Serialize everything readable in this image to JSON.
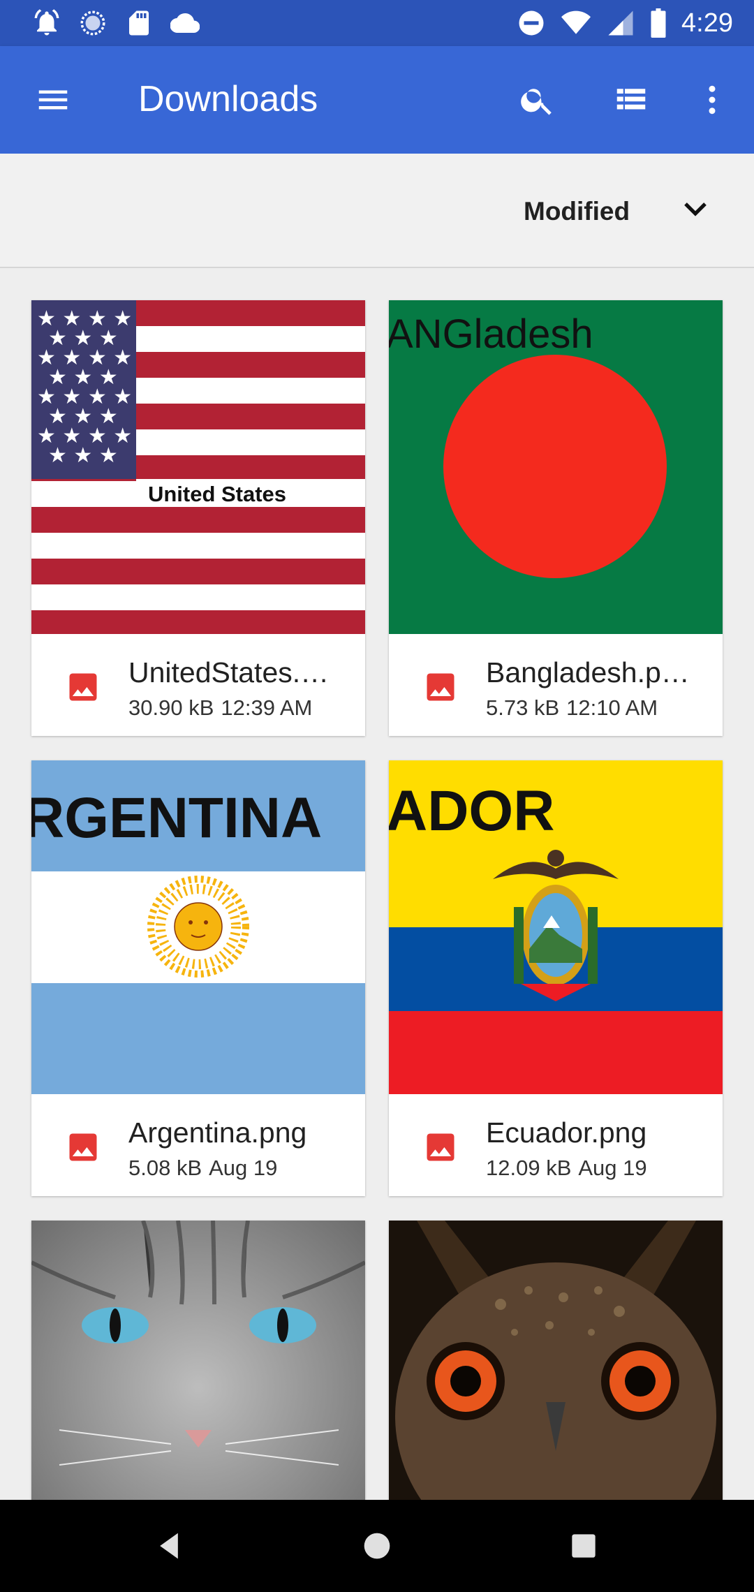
{
  "status_bar": {
    "time": "4:29",
    "left_icons": [
      "alarm-icon",
      "sync-icon",
      "sd-card-icon",
      "cloud-icon"
    ],
    "right_icons": [
      "do-not-disturb-icon",
      "wifi-icon",
      "signal-icon",
      "battery-icon"
    ]
  },
  "app_bar": {
    "title": "Downloads",
    "color": "#3867d6",
    "actions": [
      "search-icon",
      "list-view-icon",
      "more-vert-icon"
    ]
  },
  "sort": {
    "label": "Modified"
  },
  "files": [
    {
      "name": "UnitedStates.…",
      "size": "30.90 kB",
      "time": "12:39 AM",
      "thumb_caption": "United States"
    },
    {
      "name": "Bangladesh.p…",
      "size": "5.73 kB",
      "time": "12:10 AM",
      "thumb_caption": "ANGladesh"
    },
    {
      "name": "Argentina.png",
      "size": "5.08 kB",
      "time": "Aug 19",
      "thumb_caption": "RGENTINA"
    },
    {
      "name": "Ecuador.png",
      "size": "12.09 kB",
      "time": "Aug 19",
      "thumb_caption": "ADOR"
    }
  ],
  "nav": [
    "back-icon",
    "home-icon",
    "recents-icon"
  ]
}
